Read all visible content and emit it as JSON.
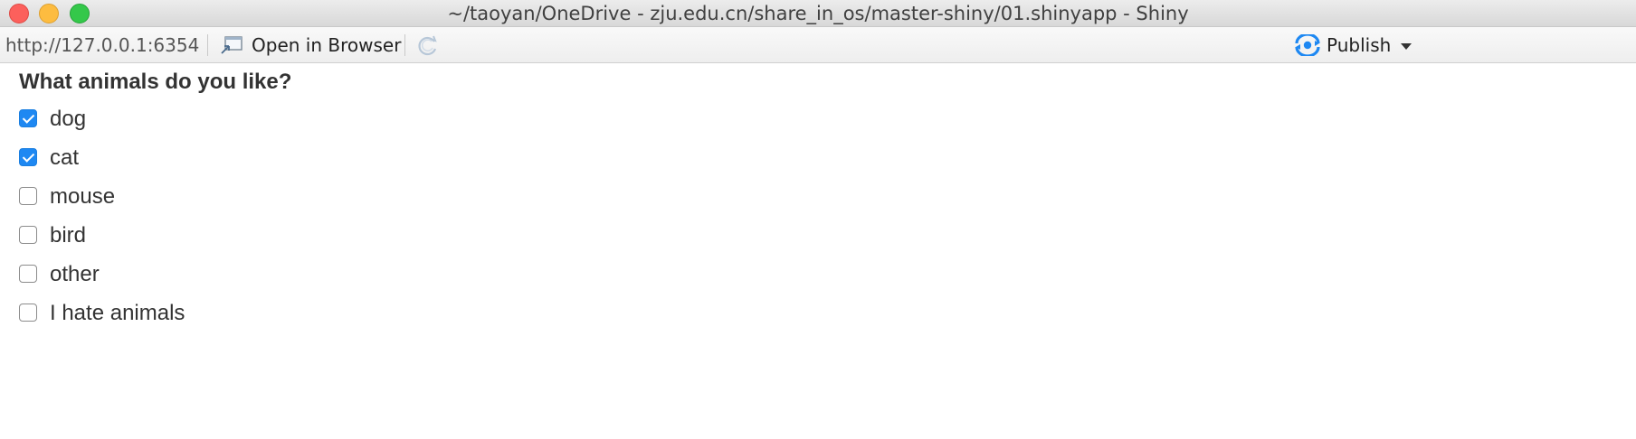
{
  "window": {
    "title": "~/taoyan/OneDrive - zju.edu.cn/share_in_os/master-shiny/01.shinyapp - Shiny"
  },
  "toolbar": {
    "url": "http://127.0.0.1:6354",
    "open_in_browser_label": "Open in Browser",
    "publish_label": "Publish",
    "accent_color": "#1e88f2"
  },
  "form": {
    "question": "What animals do you like?",
    "options": [
      {
        "label": "dog",
        "checked": true
      },
      {
        "label": "cat",
        "checked": true
      },
      {
        "label": "mouse",
        "checked": false
      },
      {
        "label": "bird",
        "checked": false
      },
      {
        "label": "other",
        "checked": false
      },
      {
        "label": "I hate animals",
        "checked": false
      }
    ]
  }
}
